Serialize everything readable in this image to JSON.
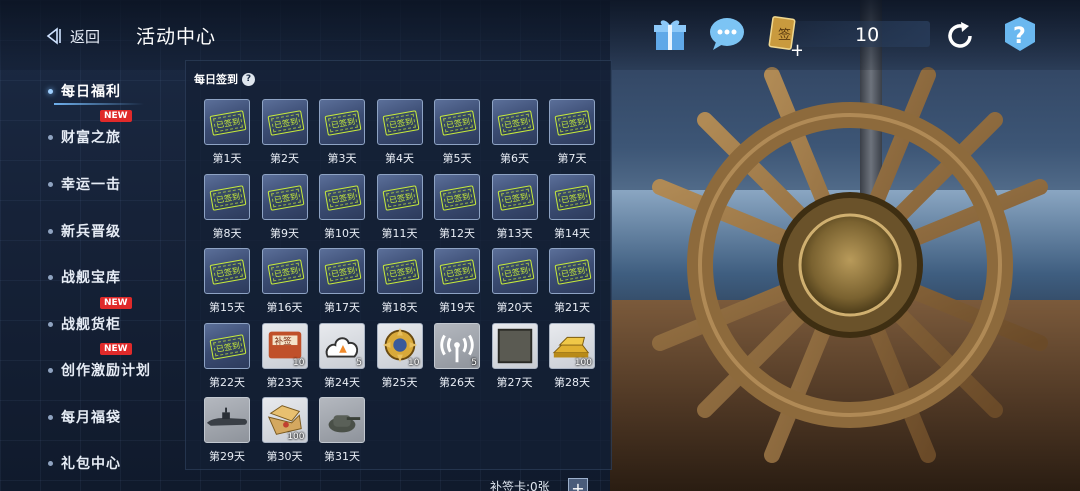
{
  "header": {
    "back_label": "返回",
    "title": "活动中心",
    "currency_value": "10",
    "icons": [
      "gift-icon",
      "chat-icon",
      "sign-card-icon",
      "refresh-icon",
      "help-icon"
    ]
  },
  "sidebar": {
    "items": [
      {
        "label": "每日福利",
        "active": true,
        "badge": ""
      },
      {
        "label": "财富之旅",
        "active": false,
        "badge": "NEW"
      },
      {
        "label": "幸运一击",
        "active": false,
        "badge": ""
      },
      {
        "label": "新兵晋级",
        "active": false,
        "badge": ""
      },
      {
        "label": "战舰宝库",
        "active": false,
        "badge": ""
      },
      {
        "label": "战舰货柜",
        "active": false,
        "badge": "NEW"
      },
      {
        "label": "创作激励计划",
        "active": false,
        "badge": "NEW"
      },
      {
        "label": "每月福袋",
        "active": false,
        "badge": ""
      },
      {
        "label": "礼包中心",
        "active": false,
        "badge": ""
      }
    ]
  },
  "signin": {
    "title": "每日签到",
    "stamp_text": "已签到",
    "days": [
      {
        "label": "第1天",
        "signed": true,
        "qty": ""
      },
      {
        "label": "第2天",
        "signed": true,
        "qty": ""
      },
      {
        "label": "第3天",
        "signed": true,
        "qty": ""
      },
      {
        "label": "第4天",
        "signed": true,
        "qty": ""
      },
      {
        "label": "第5天",
        "signed": true,
        "qty": ""
      },
      {
        "label": "第6天",
        "signed": true,
        "qty": ""
      },
      {
        "label": "第7天",
        "signed": true,
        "qty": ""
      },
      {
        "label": "第8天",
        "signed": true,
        "qty": ""
      },
      {
        "label": "第9天",
        "signed": true,
        "qty": ""
      },
      {
        "label": "第10天",
        "signed": true,
        "qty": ""
      },
      {
        "label": "第11天",
        "signed": true,
        "qty": ""
      },
      {
        "label": "第12天",
        "signed": true,
        "qty": ""
      },
      {
        "label": "第13天",
        "signed": true,
        "qty": ""
      },
      {
        "label": "第14天",
        "signed": true,
        "qty": ""
      },
      {
        "label": "第15天",
        "signed": true,
        "qty": ""
      },
      {
        "label": "第16天",
        "signed": true,
        "qty": ""
      },
      {
        "label": "第17天",
        "signed": true,
        "qty": ""
      },
      {
        "label": "第18天",
        "signed": true,
        "qty": ""
      },
      {
        "label": "第19天",
        "signed": true,
        "qty": ""
      },
      {
        "label": "第20天",
        "signed": true,
        "qty": ""
      },
      {
        "label": "第21天",
        "signed": true,
        "qty": ""
      },
      {
        "label": "第22天",
        "signed": true,
        "qty": ""
      },
      {
        "label": "第23天",
        "signed": false,
        "qty": "10",
        "art": "makeup-card",
        "art_text": "补签"
      },
      {
        "label": "第24天",
        "signed": false,
        "qty": "5",
        "art": "smoke"
      },
      {
        "label": "第25天",
        "signed": false,
        "qty": "10",
        "art": "gold-badge"
      },
      {
        "label": "第26天",
        "signed": false,
        "qty": "5",
        "art": "radar"
      },
      {
        "label": "第27天",
        "signed": false,
        "qty": "",
        "art": "plate"
      },
      {
        "label": "第28天",
        "signed": false,
        "qty": "100",
        "art": "gold-bars"
      },
      {
        "label": "第29天",
        "signed": false,
        "qty": "",
        "art": "submarine"
      },
      {
        "label": "第30天",
        "signed": false,
        "qty": "100",
        "art": "treasure"
      },
      {
        "label": "第31天",
        "signed": false,
        "qty": "",
        "art": "turret"
      }
    ]
  },
  "footer": {
    "makeup_cards": "补签卡:0张",
    "add_label": "+"
  },
  "colors": {
    "stamp": "#c7ea3c",
    "new_badge": "#e02a2a",
    "accent": "#7fc0ff"
  }
}
